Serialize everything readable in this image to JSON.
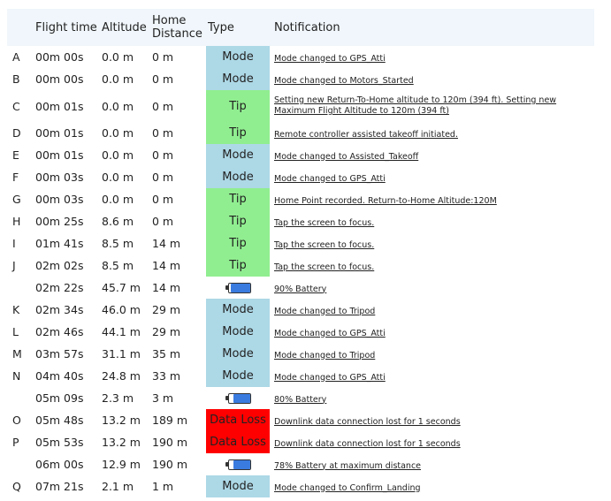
{
  "headers": {
    "id": "",
    "time": "Flight time",
    "alt": "Altitude",
    "home_line1": "Home",
    "home_line2": "Distance",
    "type": "Type",
    "notif": "Notification"
  },
  "rows": [
    {
      "id": "A",
      "time": "00m 00s",
      "alt": "0.0 m",
      "home": "0 m",
      "type": "Mode",
      "notif": "Mode changed to GPS_Atti"
    },
    {
      "id": "B",
      "time": "00m 00s",
      "alt": "0.0 m",
      "home": "0 m",
      "type": "Mode",
      "notif": "Mode changed to Motors_Started"
    },
    {
      "id": "C",
      "time": "00m 01s",
      "alt": "0.0 m",
      "home": "0 m",
      "type": "Tip",
      "notif": "Setting new Return-To-Home altitude to 120m (394 ft). Setting new Maximum Flight Altitude to 120m (394 ft)"
    },
    {
      "id": "D",
      "time": "00m 01s",
      "alt": "0.0 m",
      "home": "0 m",
      "type": "Tip",
      "notif": "Remote controller assisted takeoff initiated."
    },
    {
      "id": "E",
      "time": "00m 01s",
      "alt": "0.0 m",
      "home": "0 m",
      "type": "Mode",
      "notif": "Mode changed to Assisted_Takeoff"
    },
    {
      "id": "F",
      "time": "00m 03s",
      "alt": "0.0 m",
      "home": "0 m",
      "type": "Mode",
      "notif": "Mode changed to GPS_Atti"
    },
    {
      "id": "G",
      "time": "00m 03s",
      "alt": "0.0 m",
      "home": "0 m",
      "type": "Tip",
      "notif": "Home Point recorded. Return-to-Home Altitude:120M"
    },
    {
      "id": "H",
      "time": "00m 25s",
      "alt": "8.6 m",
      "home": "0 m",
      "type": "Tip",
      "notif": "Tap the screen to focus."
    },
    {
      "id": "I",
      "time": "01m 41s",
      "alt": "8.5 m",
      "home": "14 m",
      "type": "Tip",
      "notif": "Tap the screen to focus."
    },
    {
      "id": "J",
      "time": "02m 02s",
      "alt": "8.5 m",
      "home": "14 m",
      "type": "Tip",
      "notif": "Tap the screen to focus."
    },
    {
      "id": "",
      "time": "02m 22s",
      "alt": "45.7 m",
      "home": "14 m",
      "type": "Battery",
      "battery_level": 0.9,
      "notif": "90% Battery"
    },
    {
      "id": "K",
      "time": "02m 34s",
      "alt": "46.0 m",
      "home": "29 m",
      "type": "Mode",
      "notif": "Mode changed to Tripod"
    },
    {
      "id": "L",
      "time": "02m 46s",
      "alt": "44.1 m",
      "home": "29 m",
      "type": "Mode",
      "notif": "Mode changed to GPS_Atti"
    },
    {
      "id": "M",
      "time": "03m 57s",
      "alt": "31.1 m",
      "home": "35 m",
      "type": "Mode",
      "notif": "Mode changed to Tripod"
    },
    {
      "id": "N",
      "time": "04m 40s",
      "alt": "24.8 m",
      "home": "33 m",
      "type": "Mode",
      "notif": "Mode changed to GPS_Atti"
    },
    {
      "id": "",
      "time": "05m 09s",
      "alt": "2.3 m",
      "home": "3 m",
      "type": "Battery",
      "battery_level": 0.8,
      "notif": "80% Battery"
    },
    {
      "id": "O",
      "time": "05m 48s",
      "alt": "13.2 m",
      "home": "189 m",
      "type": "Data Loss",
      "notif": "Downlink data connection lost for 1 seconds"
    },
    {
      "id": "P",
      "time": "05m 53s",
      "alt": "13.2 m",
      "home": "190 m",
      "type": "Data Loss",
      "notif": "Downlink data connection lost for 1 seconds"
    },
    {
      "id": "",
      "time": "06m 00s",
      "alt": "12.9 m",
      "home": "190 m",
      "type": "Battery",
      "battery_level": 0.78,
      "notif": "78% Battery at maximum distance"
    },
    {
      "id": "Q",
      "time": "07m 21s",
      "alt": "2.1 m",
      "home": "1 m",
      "type": "Mode",
      "notif": "Mode changed to Confirm_Landing"
    }
  ],
  "colors": {
    "mode": "#add8e6",
    "tip": "#90ee90",
    "data_loss": "#ff0000",
    "battery_fill": "#3a7be0",
    "header_bg": "#f0f6fb"
  }
}
